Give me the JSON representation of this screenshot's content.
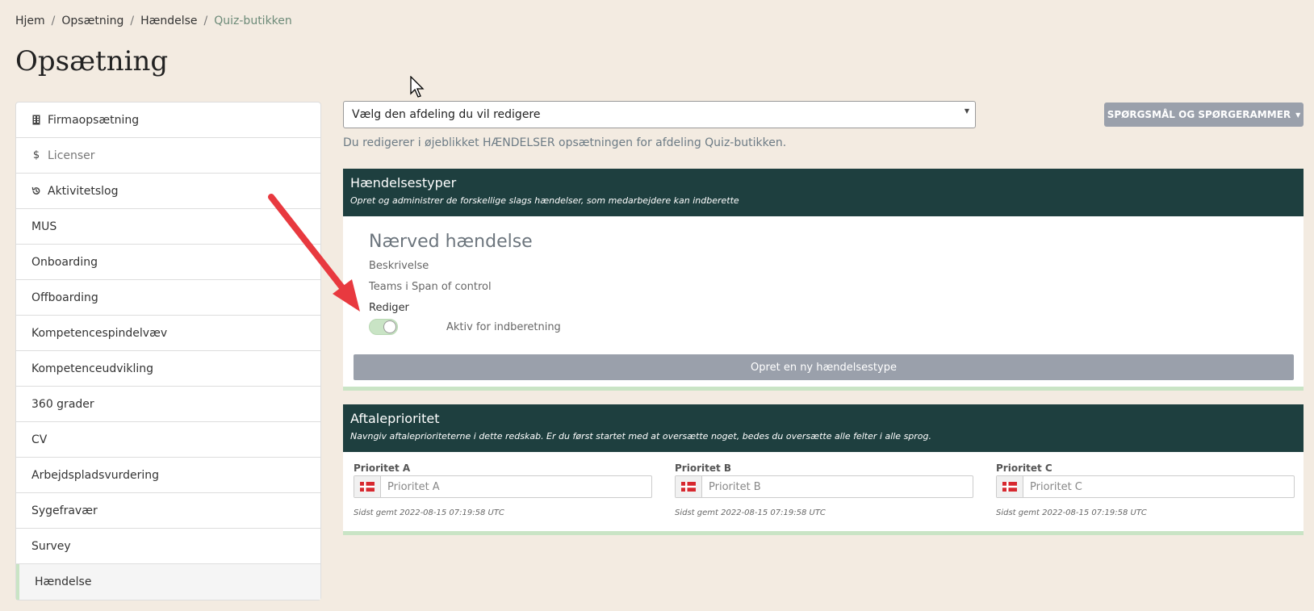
{
  "breadcrumb": {
    "items": [
      "Hjem",
      "Opsætning",
      "Hændelse"
    ],
    "active": "Quiz-butikken",
    "separator": "/"
  },
  "page_title": "Opsætning",
  "sidebar": {
    "items": [
      {
        "label": "Firmaopsætning",
        "icon": "building-icon"
      },
      {
        "label": "Licenser",
        "icon": "dollar-icon"
      },
      {
        "label": "Aktivitetslog",
        "icon": "history-icon"
      },
      {
        "label": "MUS"
      },
      {
        "label": "Onboarding"
      },
      {
        "label": "Offboarding"
      },
      {
        "label": "Kompetencespindelvæv"
      },
      {
        "label": "Kompetenceudvikling"
      },
      {
        "label": "360 grader"
      },
      {
        "label": "CV"
      },
      {
        "label": "Arbejdspladsvurdering"
      },
      {
        "label": "Sygefravær"
      },
      {
        "label": "Survey"
      },
      {
        "label": "Hændelse"
      }
    ]
  },
  "department_select": {
    "placeholder": "Vælg den afdeling du vil redigere"
  },
  "questions_button": {
    "label": "SPØRGSMÅL OG SPØRGERAMMER"
  },
  "info_text": "Du redigerer i øjeblikket HÆNDELSER opsætningen for afdeling Quiz-butikken.",
  "event_types": {
    "title": "Hændelsestyper",
    "subtitle": "Opret og administrer de forskellige slags hændelser, som medarbejdere kan indberette",
    "event": {
      "name": "Nærved hændelse",
      "description_label": "Beskrivelse",
      "teams_label": "Teams i Span of control",
      "edit_label": "Rediger",
      "active_label": "Aktiv for indberetning",
      "active": true
    },
    "new_button": "Opret en ny hændelsestype"
  },
  "priority": {
    "title": "Aftaleprioritet",
    "subtitle": "Navngiv aftaleprioriteterne i dette redskab. Er du først startet med at oversætte noget, bedes du oversætte alle felter i alle sprog.",
    "fields": [
      {
        "label": "Prioritet A",
        "placeholder": "Prioritet A",
        "saved": "Sidst gemt 2022-08-15 07:19:58 UTC"
      },
      {
        "label": "Prioritet B",
        "placeholder": "Prioritet B",
        "saved": "Sidst gemt 2022-08-15 07:19:58 UTC"
      },
      {
        "label": "Prioritet C",
        "placeholder": "Prioritet C",
        "saved": "Sidst gemt 2022-08-15 07:19:58 UTC"
      }
    ]
  },
  "colors": {
    "background": "#f3ebe1",
    "panel_header": "#1e3f3f",
    "accent_green": "#c9e4c5",
    "button_gray": "#9aa0ab",
    "annotation_arrow": "#e8393f"
  }
}
